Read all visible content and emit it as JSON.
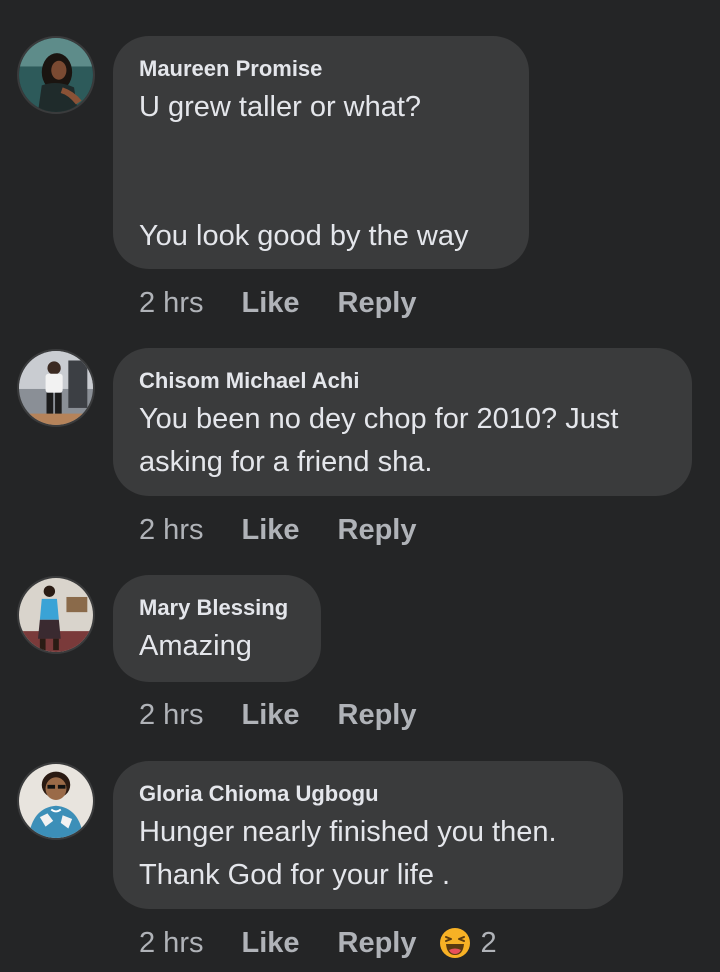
{
  "comments": [
    {
      "author": "Maureen Promise",
      "text": "U grew taller or what?\n\n\nYou look good by the way",
      "time": "2 hrs",
      "like_label": "Like",
      "reply_label": "Reply"
    },
    {
      "author": "Chisom Michael Achi",
      "text": "You been no dey chop for 2010? Just\nasking for a friend sha.",
      "time": "2 hrs",
      "like_label": "Like",
      "reply_label": "Reply"
    },
    {
      "author": "Mary Blessing",
      "text": "Amazing",
      "time": "2 hrs",
      "like_label": "Like",
      "reply_label": "Reply"
    },
    {
      "author": "Gloria Chioma Ugbogu",
      "text": "Hunger nearly finished you then.\nThank God for your life .",
      "time": "2 hrs",
      "like_label": "Like",
      "reply_label": "Reply",
      "reaction": {
        "icon": "laughing-emoji-icon",
        "count": "2"
      }
    }
  ],
  "colors": {
    "background": "#242526",
    "bubble": "#3a3b3c",
    "primary_text": "#e4e6eb",
    "secondary_text": "#b0b3b8",
    "emoji_yellow": "#f7b125"
  }
}
